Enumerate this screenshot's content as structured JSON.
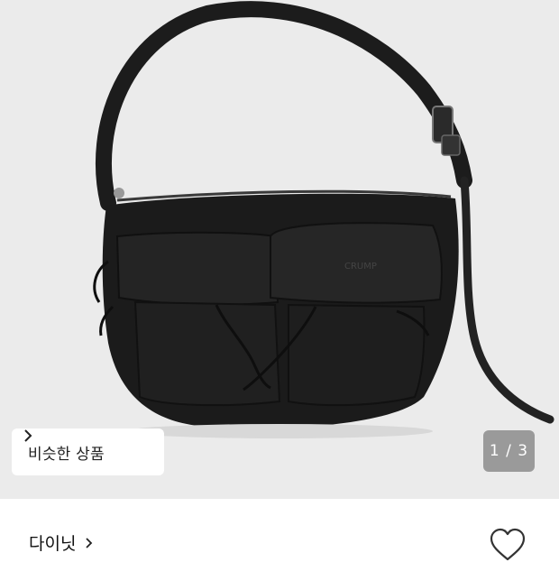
{
  "product": {
    "image_alt": "black nylon hobo shoulder bag",
    "bag_logo": "CRUMP"
  },
  "similar_products": {
    "label": "비슷한 상품",
    "icon": "chevron-right-icon"
  },
  "image_pagination": {
    "text": "1 / 3",
    "current": 1,
    "total": 3
  },
  "brand": {
    "name": "다이닛",
    "icon": "chevron-right-icon"
  },
  "like": {
    "icon": "heart-outline-icon"
  },
  "colors": {
    "image_bg": "#ebebeb",
    "counter_bg": "#9a9a9a",
    "bag": "#1a1a1a"
  }
}
